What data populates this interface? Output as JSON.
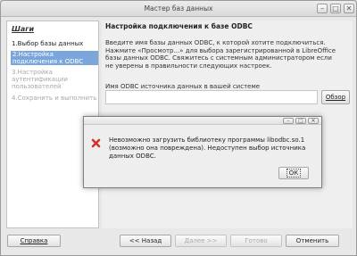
{
  "window": {
    "title": "Мастер баз данных"
  },
  "sidebar": {
    "header": "Шаги",
    "steps": [
      {
        "label": "1.Выбор базы данных",
        "state": "done"
      },
      {
        "label": "2.Настройка подключения к ODBC",
        "state": "active"
      },
      {
        "label": "3.Настройка аутентификации пользователей",
        "state": "disabled"
      },
      {
        "label": "4.Сохранить и выполнить",
        "state": "disabled"
      }
    ]
  },
  "main": {
    "heading": "Настройка подключения к базе ODBC",
    "paragraph": "Введите имя базы данных ODBC, к которой хотите подключиться. Нажмите «Просмотр...» для выбора зарегистрированной в LibreOffice базы данных ODBC. Свяжитесь с системным администратором если не уверены в правильности следующих настроек.",
    "source_label": "Имя ODBC источника данных в вашей системе",
    "source_value": "",
    "browse_label": "Обзор"
  },
  "footer": {
    "help": "Справка",
    "back": "<< Назад",
    "next": "Далее >>",
    "finish": "Готово",
    "cancel": "Отменить"
  },
  "dialog": {
    "message": "Невозможно загрузить библиотеку программы libodbc.so.1 (возможно она повреждена). Недоступен выбор источника данных ODBC.",
    "ok": "ОК",
    "icon": "error-icon"
  },
  "colors": {
    "active_step": "#7aa6dc",
    "error_icon": "#d6302e"
  }
}
